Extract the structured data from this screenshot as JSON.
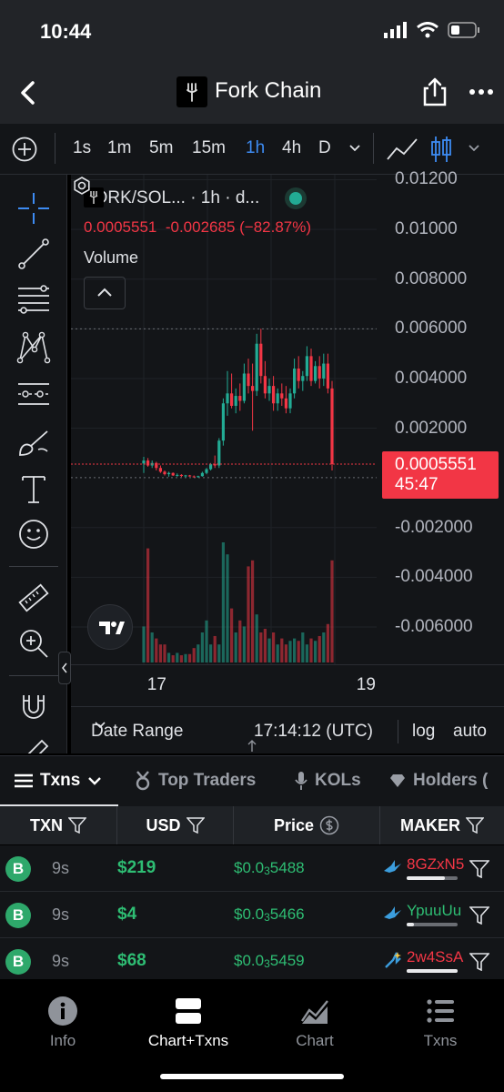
{
  "status": {
    "time": "10:44"
  },
  "header": {
    "title": "Fork Chain"
  },
  "toolbar": {
    "intervals": [
      "1s",
      "1m",
      "5m",
      "15m",
      "1h",
      "4h",
      "D"
    ],
    "active_interval": "1h"
  },
  "chart": {
    "symbol": "FORK/SOL... · 1h · d...",
    "ohlc_price": "0.0005551",
    "ohlc_change": "-0.002685 (−82.87%)",
    "volume_label": "Volume",
    "last_price": "0.0005551",
    "countdown": "45:47",
    "date_range_label": "Date Range",
    "utc_time": "17:14:12 (UTC)",
    "log_label": "log",
    "auto_label": "auto"
  },
  "chart_data": {
    "type": "bar",
    "title": "",
    "xlabel": "",
    "ylabel": "",
    "y_tick_labels": [
      "0.01200",
      "0.01000",
      "0.008000",
      "0.006000",
      "0.004000",
      "0.002000",
      "-0.002000",
      "-0.004000",
      "-0.006000"
    ],
    "y_ticks": [
      0.012,
      0.01,
      0.008,
      0.006,
      0.004,
      0.002,
      -0.002,
      -0.004,
      -0.006
    ],
    "ylim": [
      -0.0075,
      0.0122
    ],
    "x_ticks": [
      {
        "label": "17",
        "index": 3
      },
      {
        "label": "19",
        "index": 53
      }
    ],
    "last_price": 0.0005551,
    "series": [
      {
        "name": "FORK/SOL",
        "ohlc": [
          [
            0.00058,
            0.00085,
            0.0002,
            0.0007
          ],
          [
            0.0007,
            0.0008,
            0.00045,
            0.0005
          ],
          [
            0.0005,
            0.0007,
            0.0004,
            0.0006
          ],
          [
            0.0006,
            0.00065,
            0.0003,
            0.0004
          ],
          [
            0.0004,
            0.0005,
            0.0002,
            0.00025
          ],
          [
            0.00025,
            0.0003,
            0.0001,
            0.00015
          ],
          [
            0.00015,
            0.00025,
            5e-05,
            0.0002
          ],
          [
            0.0002,
            0.00022,
            8e-05,
            0.0001
          ],
          [
            0.0001,
            0.00018,
            5e-05,
            0.00012
          ],
          [
            0.00012,
            0.00015,
            4e-05,
            8e-05
          ],
          [
            8e-05,
            0.00012,
            3e-05,
            0.0001
          ],
          [
            0.0001,
            0.00012,
            5e-05,
            6e-05
          ],
          [
            6e-05,
            0.0001,
            2e-05,
            5e-05
          ],
          [
            5e-05,
            9e-05,
            1e-05,
            7e-05
          ],
          [
            7e-05,
            0.00025,
            5e-05,
            0.0002
          ],
          [
            0.0002,
            0.0004,
            0.00015,
            0.00035
          ],
          [
            0.00035,
            0.0006,
            0.0003,
            0.00055
          ],
          [
            0.00055,
            0.0009,
            0.0004,
            0.0005
          ],
          [
            0.0005,
            0.0016,
            0.0004,
            0.0015
          ],
          [
            0.0015,
            0.0032,
            0.0013,
            0.003
          ],
          [
            0.003,
            0.0043,
            0.0025,
            0.0034
          ],
          [
            0.0034,
            0.0042,
            0.0028,
            0.0029
          ],
          [
            0.0029,
            0.0036,
            0.0026,
            0.0033
          ],
          [
            0.0033,
            0.0038,
            0.0027,
            0.0031
          ],
          [
            0.0031,
            0.0046,
            0.003,
            0.0042
          ],
          [
            0.0042,
            0.0048,
            0.0034,
            0.0037
          ],
          [
            0.0037,
            0.0046,
            0.0019,
            0.0035
          ],
          [
            0.0035,
            0.0058,
            0.0033,
            0.0054
          ],
          [
            0.0054,
            0.006,
            0.0038,
            0.0041
          ],
          [
            0.0041,
            0.0047,
            0.0032,
            0.0034
          ],
          [
            0.0034,
            0.004,
            0.0031,
            0.0037
          ],
          [
            0.0037,
            0.0041,
            0.0027,
            0.003
          ],
          [
            0.003,
            0.0036,
            0.0027,
            0.0034
          ],
          [
            0.0034,
            0.0038,
            0.0029,
            0.0032
          ],
          [
            0.0032,
            0.0037,
            0.0026,
            0.0028
          ],
          [
            0.0028,
            0.0036,
            0.0026,
            0.0034
          ],
          [
            0.0034,
            0.0048,
            0.0032,
            0.0044
          ],
          [
            0.0044,
            0.0049,
            0.0036,
            0.0039
          ],
          [
            0.0039,
            0.0043,
            0.0035,
            0.0041
          ],
          [
            0.0041,
            0.0053,
            0.0039,
            0.0049
          ],
          [
            0.0049,
            0.0052,
            0.0037,
            0.0039
          ],
          [
            0.0039,
            0.0047,
            0.0038,
            0.0045
          ],
          [
            0.0045,
            0.0049,
            0.0036,
            0.004
          ],
          [
            0.004,
            0.005,
            0.0037,
            0.0046
          ],
          [
            0.0046,
            0.005,
            0.0034,
            0.0036
          ],
          [
            0.0036,
            0.0039,
            0.0003,
            0.0005551
          ]
        ]
      }
    ],
    "volume": [
      0.3,
      0.95,
      0.25,
      0.2,
      0.15,
      0.15,
      0.08,
      0.06,
      0.08,
      0.06,
      0.07,
      0.07,
      0.12,
      0.15,
      0.25,
      0.35,
      0.15,
      0.22,
      0.15,
      1.0,
      0.9,
      0.45,
      0.25,
      0.35,
      0.3,
      0.8,
      0.85,
      0.4,
      0.25,
      0.28,
      0.2,
      0.25,
      0.15,
      0.2,
      0.15,
      0.18,
      0.2,
      0.18,
      0.25,
      0.15,
      0.2,
      0.18,
      0.22,
      0.25,
      0.32,
      0.85
    ]
  },
  "tabs": [
    {
      "label": "Txns",
      "active": true
    },
    {
      "label": "Top Traders",
      "active": false
    },
    {
      "label": "KOLs",
      "active": false
    },
    {
      "label": "Holders (",
      "active": false
    }
  ],
  "table": {
    "headers": [
      "TXN",
      "USD",
      "Price",
      "MAKER"
    ],
    "rows": [
      {
        "type": "B",
        "age": "9s",
        "usd": "$219",
        "price_prefix": "$0.0",
        "price_zeros": "3",
        "price_digits": "5488",
        "maker": "8GZxN5",
        "maker_color": "#f23645",
        "maker_fill": 0.75
      },
      {
        "type": "B",
        "age": "9s",
        "usd": "$4",
        "price_prefix": "$0.0",
        "price_zeros": "3",
        "price_digits": "5466",
        "maker": "YpuuUu",
        "maker_color": "#2ebd73",
        "maker_fill": 0.15
      },
      {
        "type": "B",
        "age": "9s",
        "usd": "$68",
        "price_prefix": "$0.0",
        "price_zeros": "3",
        "price_digits": "5459",
        "maker": "2w4SsA",
        "maker_color": "#f23645",
        "maker_fill": 1.0
      }
    ]
  },
  "nav": [
    {
      "label": "Info",
      "active": false
    },
    {
      "label": "Chart+Txns",
      "active": true
    },
    {
      "label": "Chart",
      "active": false
    },
    {
      "label": "Txns",
      "active": false
    }
  ],
  "colors": {
    "up": "#22ab94",
    "down": "#f23645",
    "accent": "#3d8bf2"
  }
}
